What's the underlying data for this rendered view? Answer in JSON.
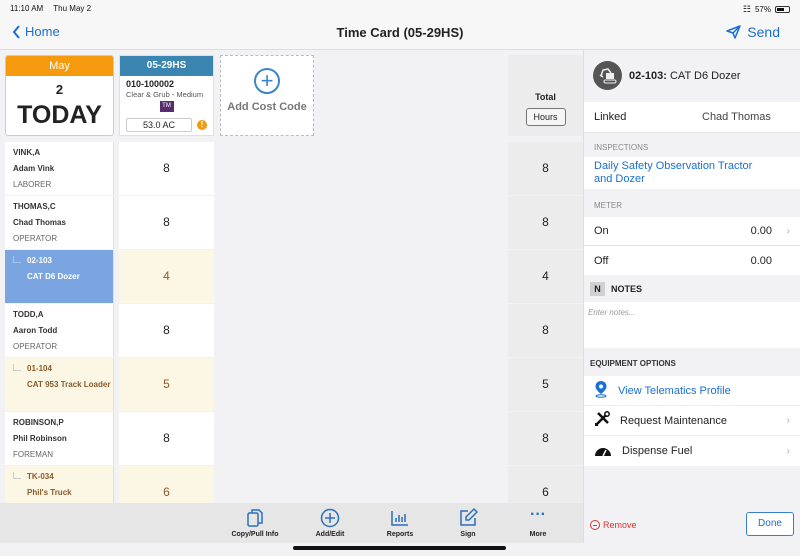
{
  "status_bar": {
    "time": "11:10 AM",
    "date": "Thu May 2",
    "battery": "57%",
    "battery_level": 0.57
  },
  "nav": {
    "back_label": "Home",
    "title": "Time Card (05-29HS)",
    "send_label": "Send"
  },
  "date_card": {
    "month": "May",
    "day": "2",
    "label": "TODAY"
  },
  "cost_code": {
    "header": "05-29HS",
    "code": "010-100002",
    "description": "Clear & Grub - Medium",
    "badge": "TM",
    "quantity": "53.0 AC",
    "warning": "!"
  },
  "add_cost_code": {
    "label": "Add Cost Code"
  },
  "total": {
    "label": "Total",
    "unit_button": "Hours"
  },
  "rows": [
    {
      "type": "employee",
      "code": "VINK,A",
      "name": "Adam Vink",
      "role": "LABORER",
      "hours": "8",
      "total": "8"
    },
    {
      "type": "employee",
      "code": "THOMAS,C",
      "name": "Chad Thomas",
      "role": "OPERATOR",
      "hours": "8",
      "total": "8"
    },
    {
      "type": "equipment",
      "code": "02-103",
      "name": "CAT D6 Dozer",
      "role": "",
      "hours": "4",
      "total": "4",
      "selected": true
    },
    {
      "type": "employee",
      "code": "TODD,A",
      "name": "Aaron Todd",
      "role": "OPERATOR",
      "hours": "8",
      "total": "8"
    },
    {
      "type": "equipment",
      "code": "01-104",
      "name": "CAT 953 Track Loader",
      "role": "",
      "hours": "5",
      "total": "5"
    },
    {
      "type": "employee",
      "code": "ROBINSON,P",
      "name": "Phil Robinson",
      "role": "FOREMAN",
      "hours": "8",
      "total": "8"
    },
    {
      "type": "equipment",
      "code": "TK-034",
      "name": "Phil's Truck",
      "role": "",
      "hours": "6",
      "total": "6"
    }
  ],
  "toolbar": [
    {
      "label": "Copy/Pull Info",
      "icon": "copy-icon"
    },
    {
      "label": "Add/Edit",
      "icon": "add-circle-icon"
    },
    {
      "label": "Reports",
      "icon": "bar-chart-icon"
    },
    {
      "label": "Sign",
      "icon": "edit-icon"
    },
    {
      "label": "More",
      "icon": "more-icon"
    }
  ],
  "panel": {
    "equipment_code": "02-103:",
    "equipment_name": "CAT D6 Dozer",
    "linked_label": "Linked",
    "linked_value": "Chad Thomas",
    "inspections_label": "INSPECTIONS",
    "inspection_link": "Daily Safety Observation Tractor and Dozer",
    "meter_label": "METER",
    "meter_on_label": "On",
    "meter_on_value": "0.00",
    "meter_off_label": "Off",
    "meter_off_value": "0.00",
    "notes_badge": "N",
    "notes_label": "NOTES",
    "notes_placeholder": "Enter notes...",
    "equipment_options_label": "EQUIPMENT OPTIONS",
    "options": [
      {
        "label": "View Telematics Profile",
        "icon": "location-pin-icon"
      },
      {
        "label": "Request Maintenance",
        "icon": "tools-icon"
      },
      {
        "label": "Dispense Fuel",
        "icon": "fuel-gauge-icon"
      }
    ],
    "remove_label": "Remove",
    "done_label": "Done"
  }
}
